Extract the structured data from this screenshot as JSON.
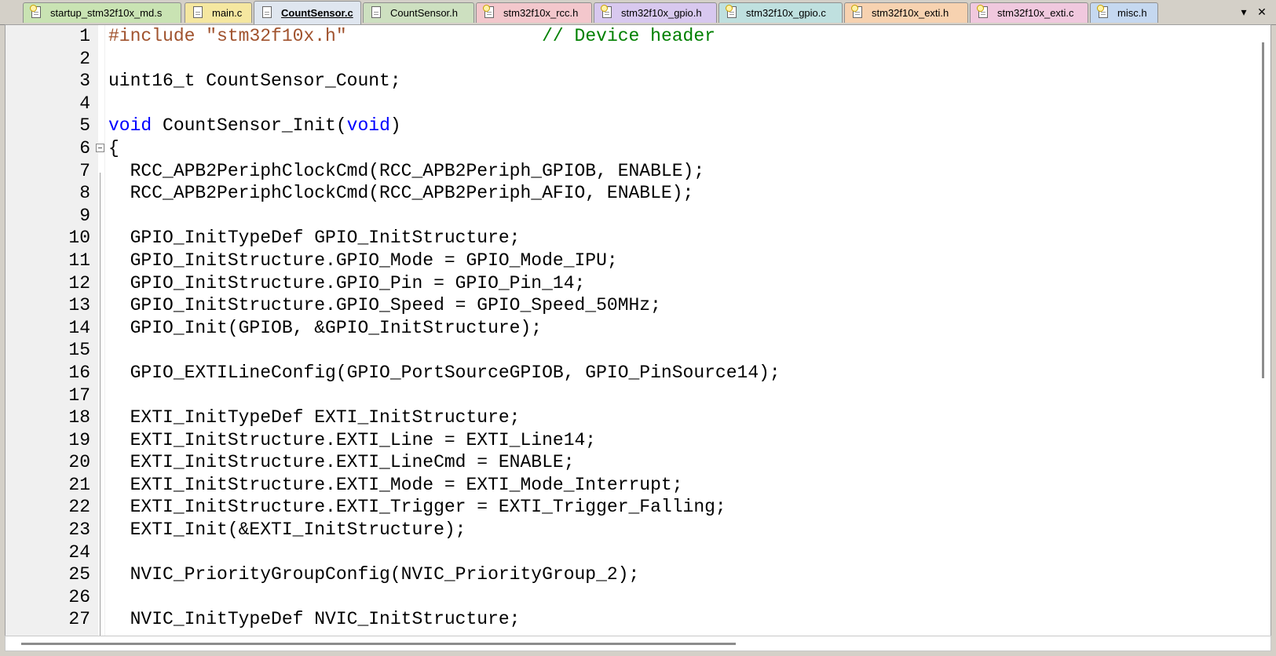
{
  "tabs": [
    {
      "label": "startup_stm32f10x_md.s",
      "color": "#c9e3b3",
      "active": false,
      "icon": "file-key-icon"
    },
    {
      "label": "main.c",
      "color": "#f5e7a0",
      "active": false,
      "icon": "file-icon"
    },
    {
      "label": "CountSensor.c",
      "color": "#dfe6ef",
      "active": true,
      "icon": "file-icon"
    },
    {
      "label": "CountSensor.h",
      "color": "#cde0c0",
      "active": false,
      "icon": "file-icon"
    },
    {
      "label": "stm32f10x_rcc.h",
      "color": "#f3c7cc",
      "active": false,
      "icon": "file-key-icon"
    },
    {
      "label": "stm32f10x_gpio.h",
      "color": "#d8c8ef",
      "active": false,
      "icon": "file-key-icon"
    },
    {
      "label": "stm32f10x_gpio.c",
      "color": "#bfe0df",
      "active": false,
      "icon": "file-key-icon"
    },
    {
      "label": "stm32f10x_exti.h",
      "color": "#f7d2b0",
      "active": false,
      "icon": "file-key-icon"
    },
    {
      "label": "stm32f10x_exti.c",
      "color": "#f0c8de",
      "active": false,
      "icon": "file-key-icon"
    },
    {
      "label": "misc.h",
      "color": "#c5d8f0",
      "active": false,
      "icon": "file-key-icon"
    }
  ],
  "tab_controls": {
    "dropdown": "▾",
    "close": "✕"
  },
  "code_lines": [
    {
      "num": "1",
      "segments": [
        {
          "t": "#include ",
          "c": "pp"
        },
        {
          "t": "\"stm32f10x.h\"",
          "c": "str"
        },
        {
          "t": "                  ",
          "c": ""
        },
        {
          "t": "// Device header",
          "c": "cmt"
        }
      ]
    },
    {
      "num": "2",
      "segments": []
    },
    {
      "num": "3",
      "segments": [
        {
          "t": "uint16_t CountSensor_Count;",
          "c": ""
        }
      ]
    },
    {
      "num": "4",
      "segments": []
    },
    {
      "num": "5",
      "segments": [
        {
          "t": "void",
          "c": "kw"
        },
        {
          "t": " CountSensor_Init(",
          "c": ""
        },
        {
          "t": "void",
          "c": "kw"
        },
        {
          "t": ")",
          "c": ""
        }
      ]
    },
    {
      "num": "6",
      "segments": [
        {
          "t": "{",
          "c": ""
        }
      ],
      "fold": true
    },
    {
      "num": "7",
      "segments": [
        {
          "t": "  RCC_APB2PeriphClockCmd(RCC_APB2Periph_GPIOB, ENABLE);",
          "c": ""
        }
      ]
    },
    {
      "num": "8",
      "segments": [
        {
          "t": "  RCC_APB2PeriphClockCmd(RCC_APB2Periph_AFIO, ENABLE);",
          "c": ""
        }
      ]
    },
    {
      "num": "9",
      "segments": []
    },
    {
      "num": "10",
      "segments": [
        {
          "t": "  GPIO_InitTypeDef GPIO_InitStructure;",
          "c": ""
        }
      ]
    },
    {
      "num": "11",
      "segments": [
        {
          "t": "  GPIO_InitStructure.GPIO_Mode = GPIO_Mode_IPU;",
          "c": ""
        }
      ]
    },
    {
      "num": "12",
      "segments": [
        {
          "t": "  GPIO_InitStructure.GPIO_Pin = GPIO_Pin_14;",
          "c": ""
        }
      ]
    },
    {
      "num": "13",
      "segments": [
        {
          "t": "  GPIO_InitStructure.GPIO_Speed = GPIO_Speed_50MHz;",
          "c": ""
        }
      ]
    },
    {
      "num": "14",
      "segments": [
        {
          "t": "  GPIO_Init(GPIOB, &GPIO_InitStructure);",
          "c": ""
        }
      ]
    },
    {
      "num": "15",
      "segments": []
    },
    {
      "num": "16",
      "segments": [
        {
          "t": "  GPIO_EXTILineConfig(GPIO_PortSourceGPIOB, GPIO_PinSource14);",
          "c": ""
        }
      ]
    },
    {
      "num": "17",
      "segments": []
    },
    {
      "num": "18",
      "segments": [
        {
          "t": "  EXTI_InitTypeDef EXTI_InitStructure;",
          "c": ""
        }
      ]
    },
    {
      "num": "19",
      "segments": [
        {
          "t": "  EXTI_InitStructure.EXTI_Line = EXTI_Line14;",
          "c": ""
        }
      ]
    },
    {
      "num": "20",
      "segments": [
        {
          "t": "  EXTI_InitStructure.EXTI_LineCmd = ENABLE;",
          "c": ""
        }
      ]
    },
    {
      "num": "21",
      "segments": [
        {
          "t": "  EXTI_InitStructure.EXTI_Mode = EXTI_Mode_Interrupt;",
          "c": ""
        }
      ]
    },
    {
      "num": "22",
      "segments": [
        {
          "t": "  EXTI_InitStructure.EXTI_Trigger = EXTI_Trigger_Falling;",
          "c": ""
        }
      ]
    },
    {
      "num": "23",
      "segments": [
        {
          "t": "  EXTI_Init(&EXTI_InitStructure);",
          "c": ""
        }
      ]
    },
    {
      "num": "24",
      "segments": []
    },
    {
      "num": "25",
      "segments": [
        {
          "t": "  NVIC_PriorityGroupConfig(NVIC_PriorityGroup_2);",
          "c": ""
        }
      ]
    },
    {
      "num": "26",
      "segments": []
    },
    {
      "num": "27",
      "segments": [
        {
          "t": "  NVIC_InitTypeDef NVIC_InitStructure;",
          "c": ""
        }
      ]
    }
  ]
}
